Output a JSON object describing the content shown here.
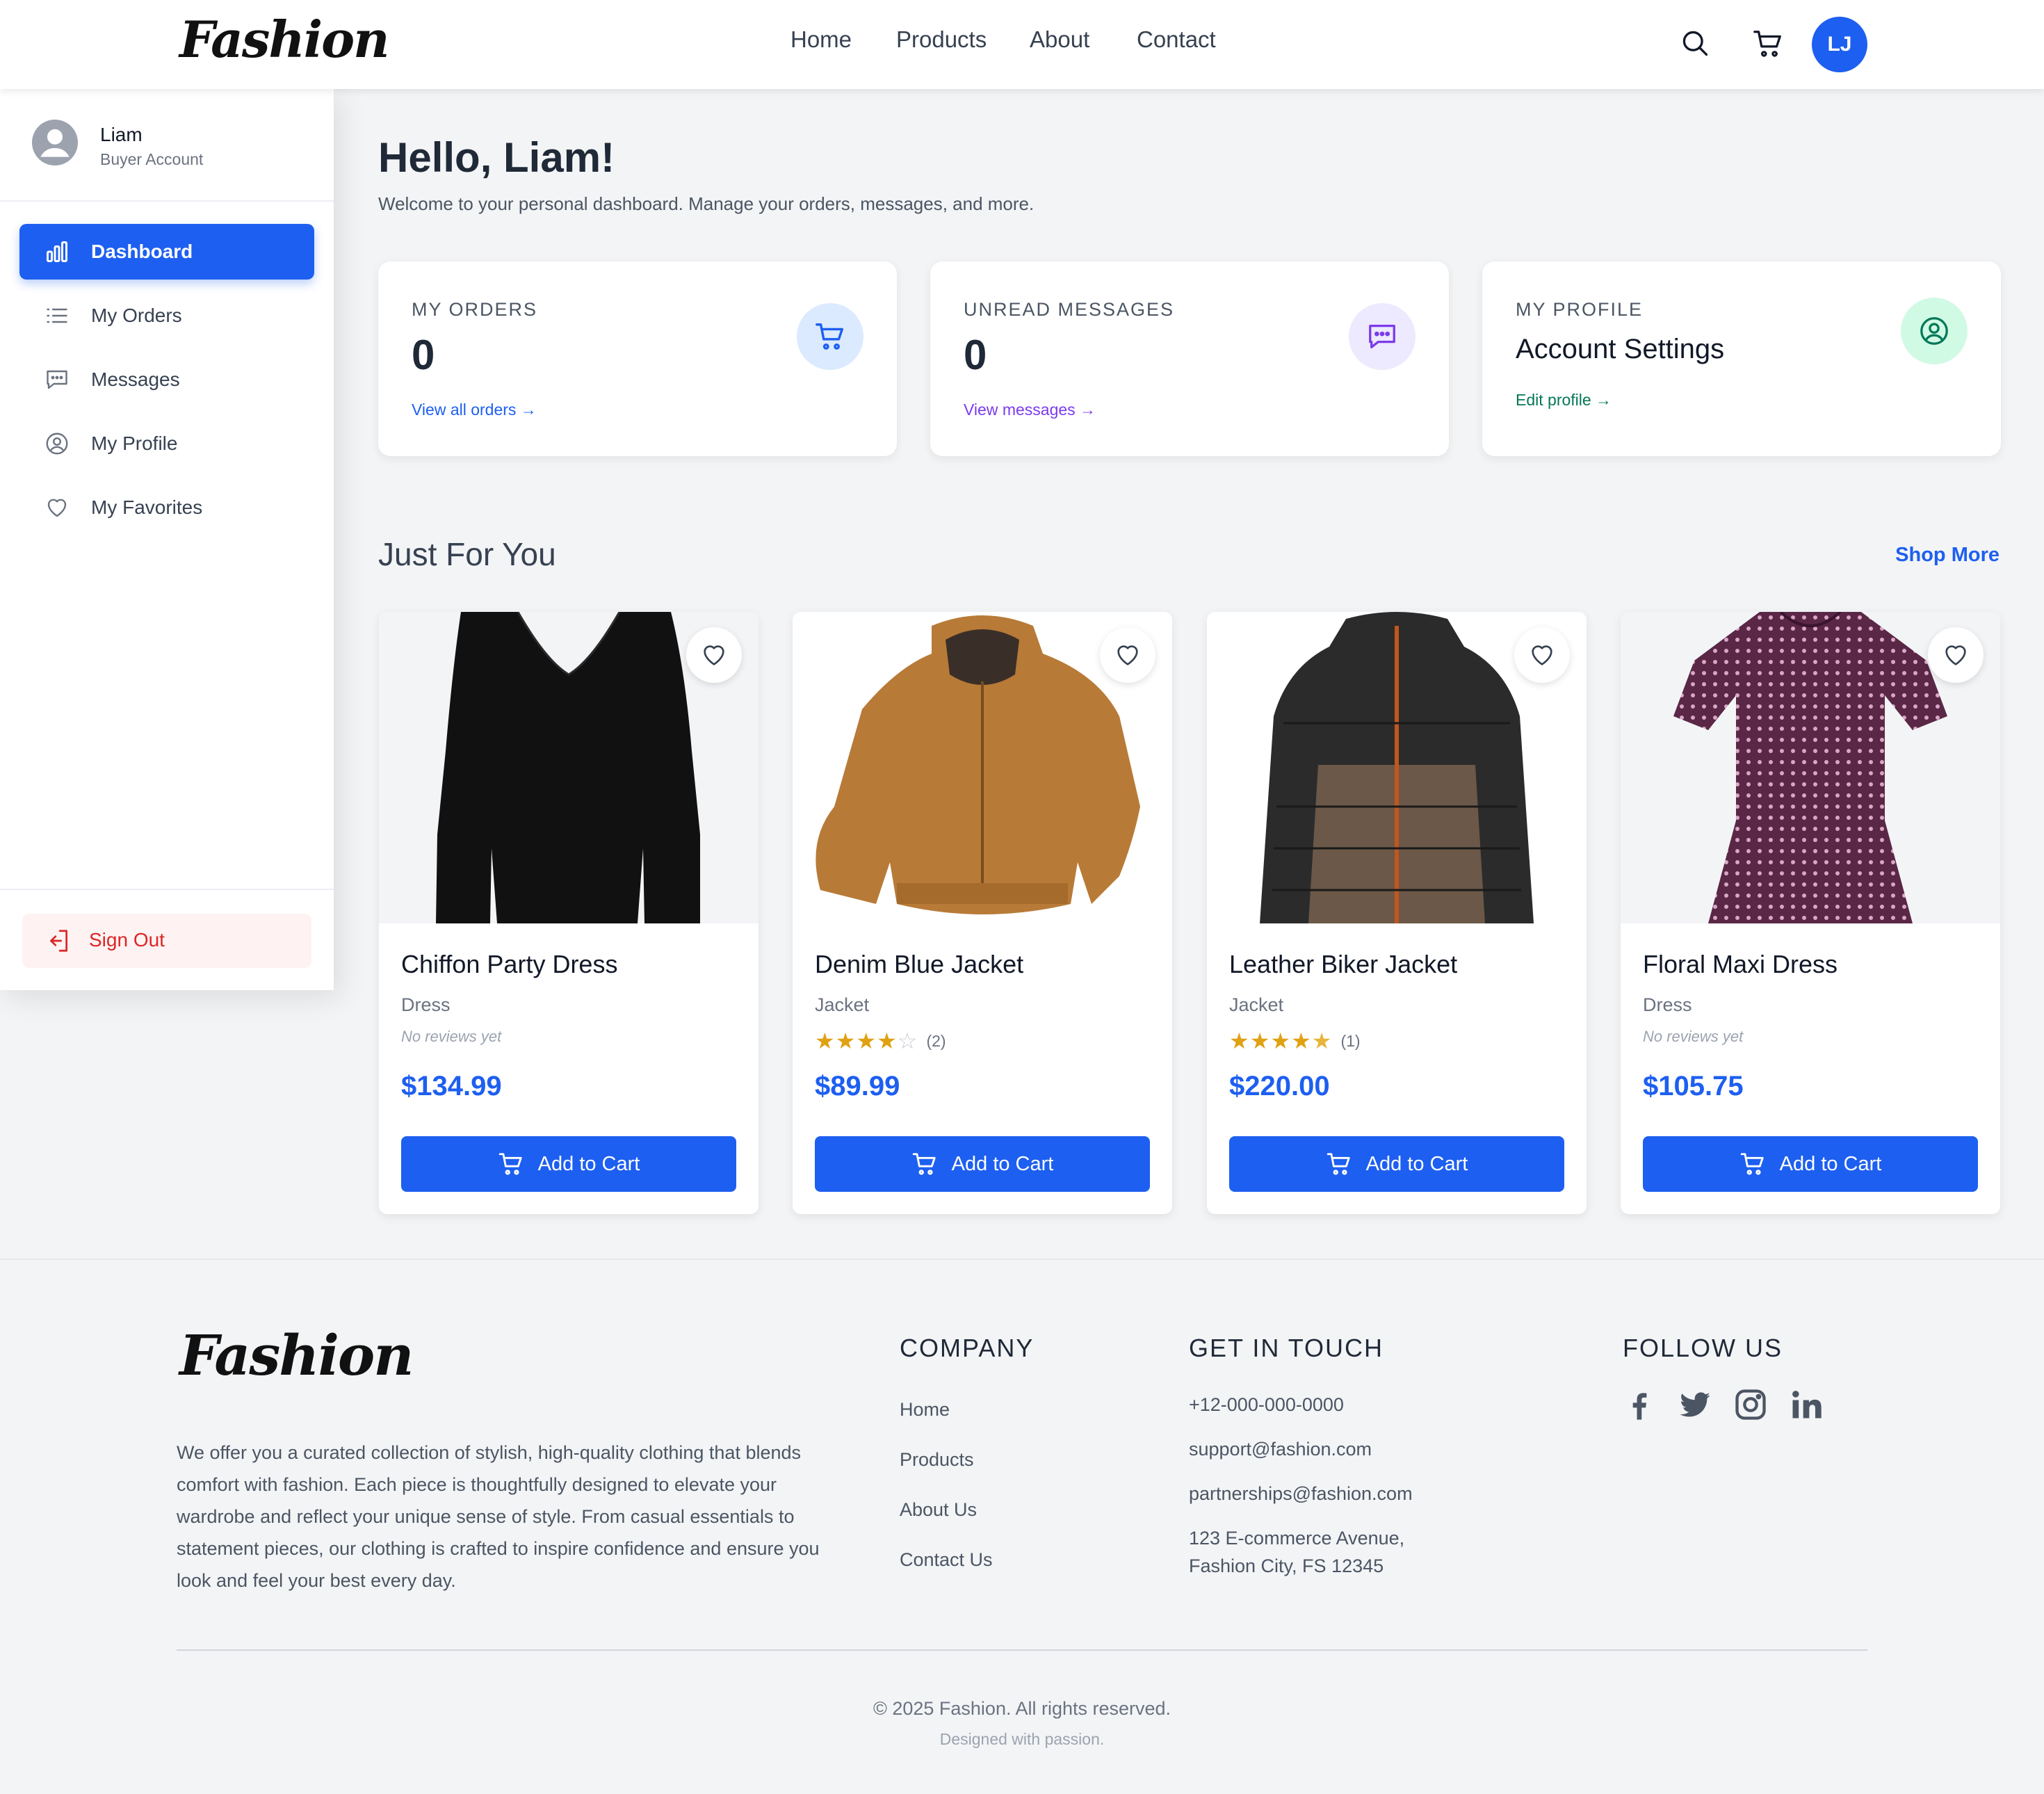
{
  "header": {
    "logo": "Fashion",
    "nav": [
      "Home",
      "Products",
      "About",
      "Contact"
    ],
    "user_initials": "LJ"
  },
  "sidebar": {
    "user_name": "Liam",
    "user_role": "Buyer Account",
    "items": [
      {
        "label": "Dashboard",
        "icon": "chart-bars-icon",
        "active": true
      },
      {
        "label": "My Orders",
        "icon": "list-icon"
      },
      {
        "label": "Messages",
        "icon": "message-icon"
      },
      {
        "label": "My Profile",
        "icon": "user-circle-icon"
      },
      {
        "label": "My Favorites",
        "icon": "heart-icon"
      }
    ],
    "sign_out": "Sign Out"
  },
  "main": {
    "greeting": "Hello, Liam!",
    "welcome": "Welcome to your personal dashboard. Manage your orders, messages, and more.",
    "cards": [
      {
        "label": "MY ORDERS",
        "value": "0",
        "link": "View all orders →",
        "icon": "cart-icon",
        "color": "#1d5ff0",
        "bg": "#dbeafe"
      },
      {
        "label": "UNREAD MESSAGES",
        "value": "0",
        "link": "View messages →",
        "icon": "message-icon",
        "color": "#7c3aed",
        "bg": "#ede9fe"
      },
      {
        "label": "MY PROFILE",
        "value": "Account Settings",
        "link": "Edit profile →",
        "icon": "user-circle-icon",
        "color": "#047857",
        "bg": "#d1fae5"
      }
    ],
    "section_title": "Just For You",
    "shop_more": "Shop More",
    "products": [
      {
        "name": "Chiffon Party Dress",
        "category": "Dress",
        "rating": null,
        "rating_text": "No reviews yet",
        "price": "$134.99"
      },
      {
        "name": "Denim Blue Jacket",
        "category": "Jacket",
        "rating": 4,
        "count": "(2)",
        "price": "$89.99"
      },
      {
        "name": "Leather Biker Jacket",
        "category": "Jacket",
        "rating": 4.5,
        "count": "(1)",
        "price": "$220.00"
      },
      {
        "name": "Floral Maxi Dress",
        "category": "Dress",
        "rating": null,
        "rating_text": "No reviews yet",
        "price": "$105.75"
      }
    ],
    "add_to_cart": "Add to Cart"
  },
  "footer": {
    "logo": "Fashion",
    "about": "We offer you a curated collection of stylish, high-quality clothing that blends comfort with fashion. Each piece is thoughtfully designed to elevate your wardrobe and reflect your unique sense of style. From casual essentials to statement pieces, our clothing is crafted to inspire confidence and ensure you look and feel your best every day.",
    "company_heading": "COMPANY",
    "company_links": [
      "Home",
      "Products",
      "About Us",
      "Contact Us"
    ],
    "contact_heading": "GET IN TOUCH",
    "phone": "+12-000-000-0000",
    "email_support": "support@fashion.com",
    "email_partners": "partnerships@fashion.com",
    "address_line1": "123 E-commerce Avenue,",
    "address_line2": "Fashion City, FS 12345",
    "follow_heading": "FOLLOW US",
    "social": [
      "facebook-icon",
      "twitter-icon",
      "instagram-icon",
      "linkedin-icon"
    ],
    "copyright": "© 2025 Fashion. All rights reserved.",
    "designed": "Designed with passion."
  }
}
